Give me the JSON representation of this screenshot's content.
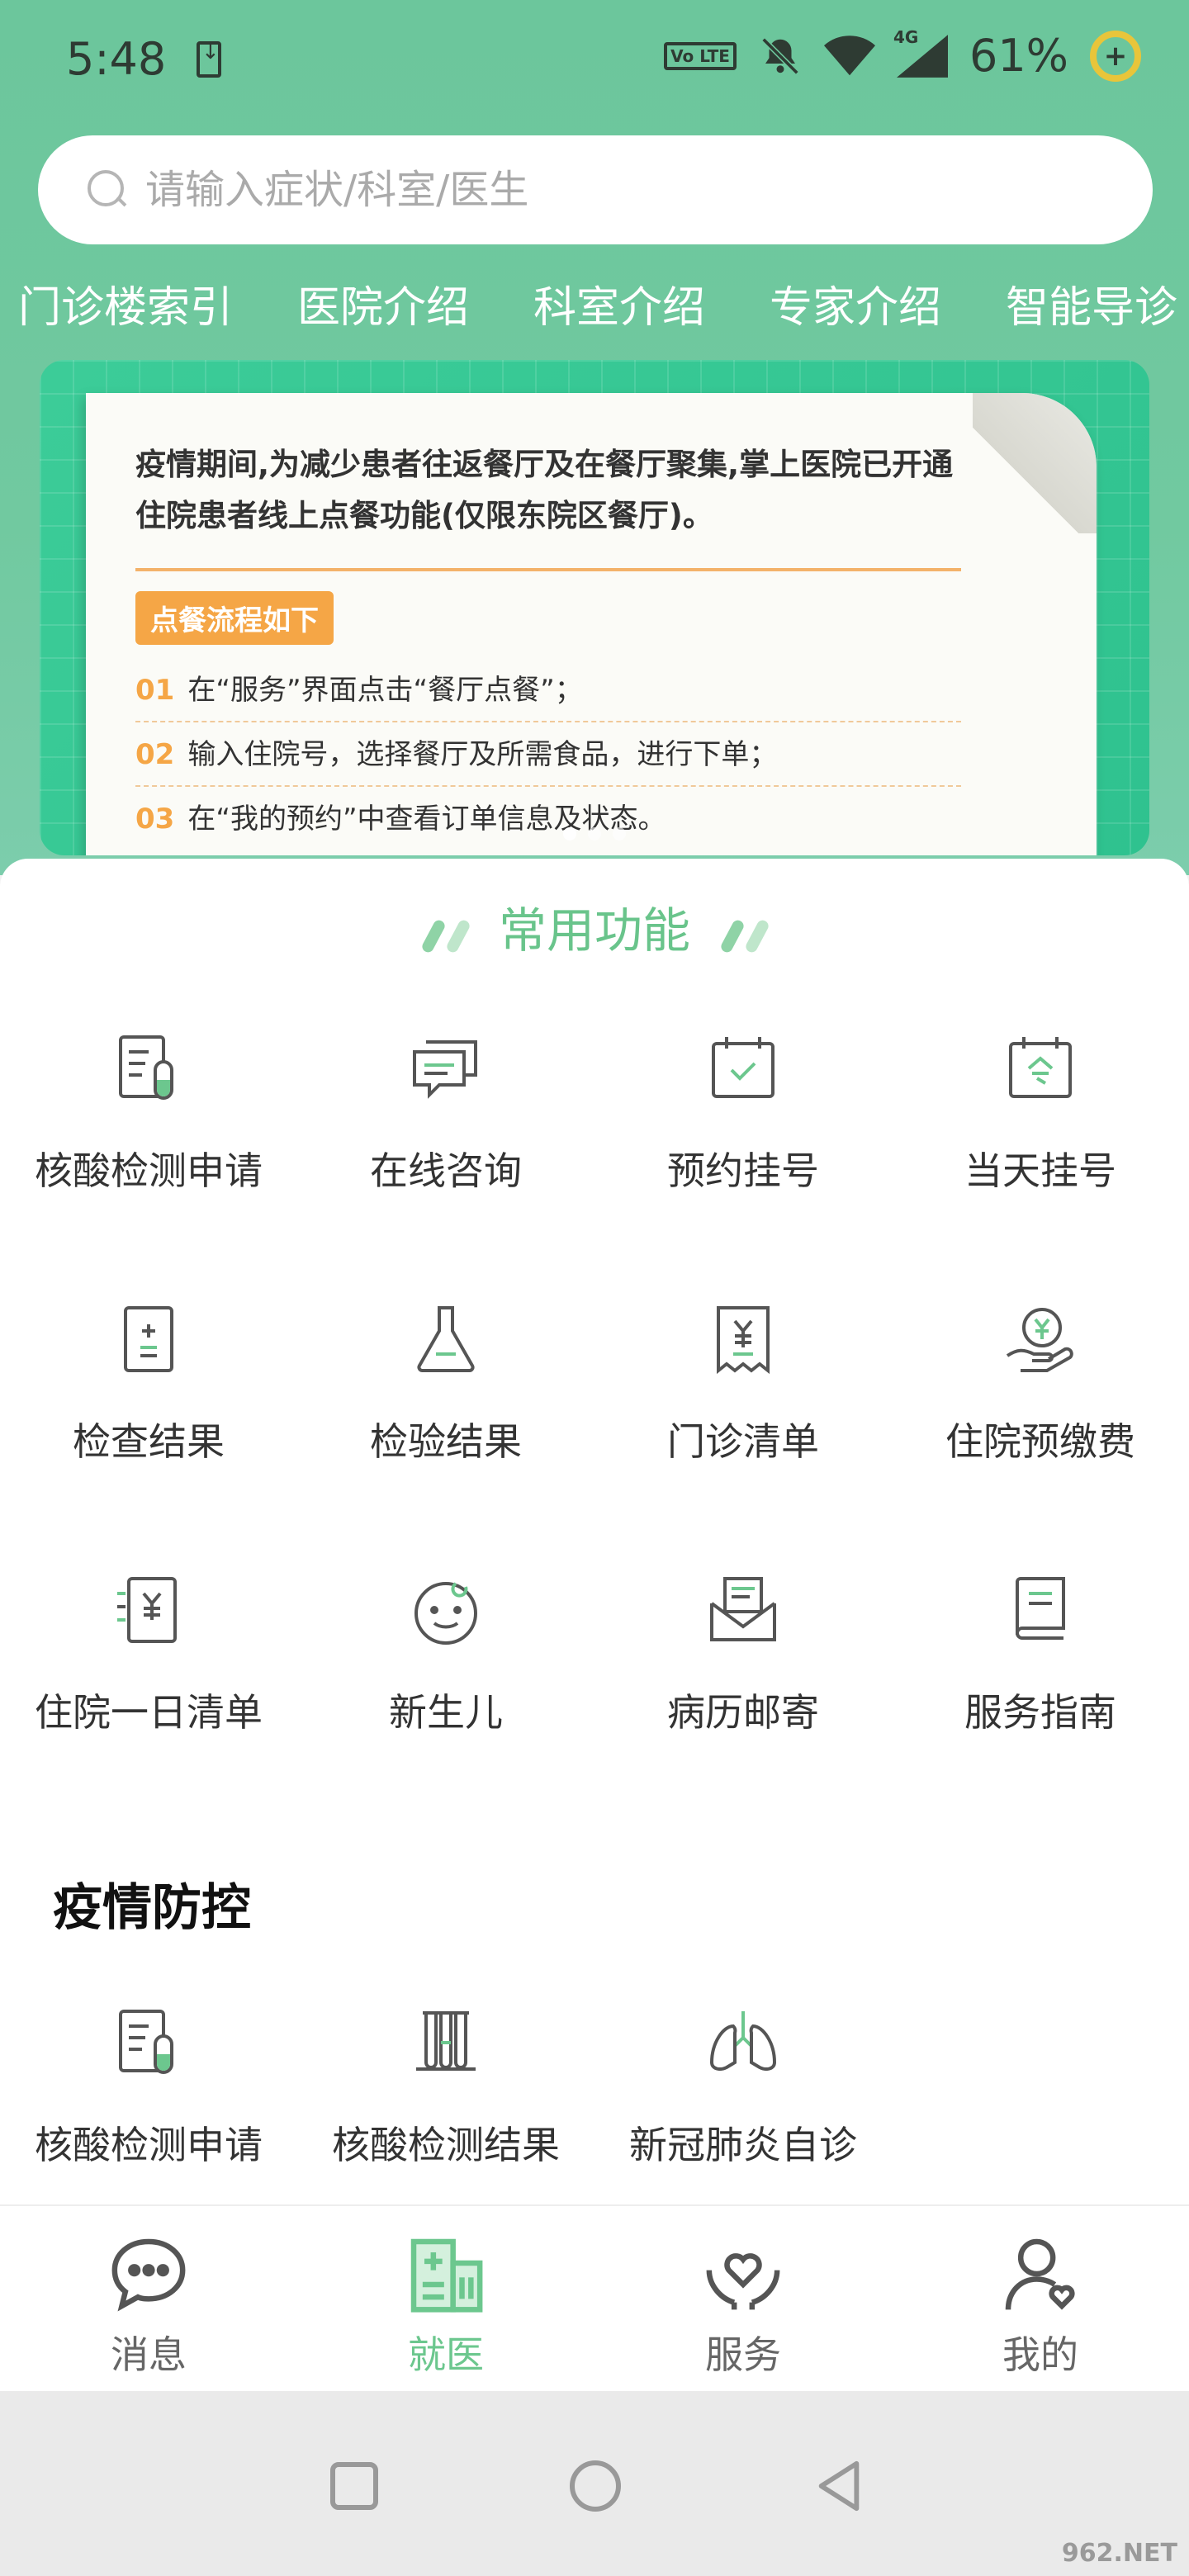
{
  "status_bar": {
    "time": "5:48",
    "volte": "Vo LTE",
    "network": "4G",
    "battery": "61%",
    "battery_charge_glyph": "+"
  },
  "search": {
    "placeholder": "请输入症状/科室/医生"
  },
  "quick_nav": [
    "门诊楼索引",
    "医院介绍",
    "科室介绍",
    "专家介绍",
    "智能导诊"
  ],
  "banner": {
    "intro": "疫情期间,为减少患者往返餐厅及在餐厅聚集,掌上医院已开通住院患者线上点餐功能(仅限东院区餐厅)。",
    "tag": "点餐流程如下",
    "steps": [
      {
        "num": "01",
        "text": "在“服务”界面点击“餐厅点餐”；"
      },
      {
        "num": "02",
        "text": "输入住院号，选择餐厅及所需食品，进行下单；"
      },
      {
        "num": "03",
        "text": "在“我的预约”中查看订单信息及状态。"
      }
    ],
    "page_count": 3,
    "active_page": 1
  },
  "common": {
    "title": "常用功能",
    "items": [
      {
        "label": "核酸检测申请",
        "icon": "test-tube-form-icon"
      },
      {
        "label": "在线咨询",
        "icon": "chat-bubbles-icon"
      },
      {
        "label": "预约挂号",
        "icon": "calendar-check-icon"
      },
      {
        "label": "当天挂号",
        "icon": "calendar-today-icon"
      },
      {
        "label": "检查结果",
        "icon": "report-icon"
      },
      {
        "label": "检验结果",
        "icon": "flask-icon"
      },
      {
        "label": "门诊清单",
        "icon": "receipt-icon"
      },
      {
        "label": "住院预缴费",
        "icon": "hand-coin-icon"
      },
      {
        "label": "住院一日清单",
        "icon": "bill-list-icon"
      },
      {
        "label": "新生儿",
        "icon": "baby-face-icon"
      },
      {
        "label": "病历邮寄",
        "icon": "mail-icon"
      },
      {
        "label": "服务指南",
        "icon": "book-icon"
      }
    ]
  },
  "epidemic": {
    "title": "疫情防控",
    "items": [
      {
        "label": "核酸检测申请",
        "icon": "test-tube-form-icon"
      },
      {
        "label": "核酸检测结果",
        "icon": "test-tubes-icon"
      },
      {
        "label": "新冠肺炎自诊",
        "icon": "lungs-icon"
      }
    ]
  },
  "tabs": [
    {
      "label": "消息",
      "icon": "message-icon",
      "active": false
    },
    {
      "label": "就医",
      "icon": "hospital-icon",
      "active": true
    },
    {
      "label": "服务",
      "icon": "heart-hands-icon",
      "active": false
    },
    {
      "label": "我的",
      "icon": "user-heart-icon",
      "active": false
    }
  ],
  "colors": {
    "brand_green": "#6cc49a",
    "icon_stroke": "#555555",
    "icon_accent": "#6cc78e",
    "banner_orange": "#f5a646"
  },
  "watermark": "962.NET"
}
